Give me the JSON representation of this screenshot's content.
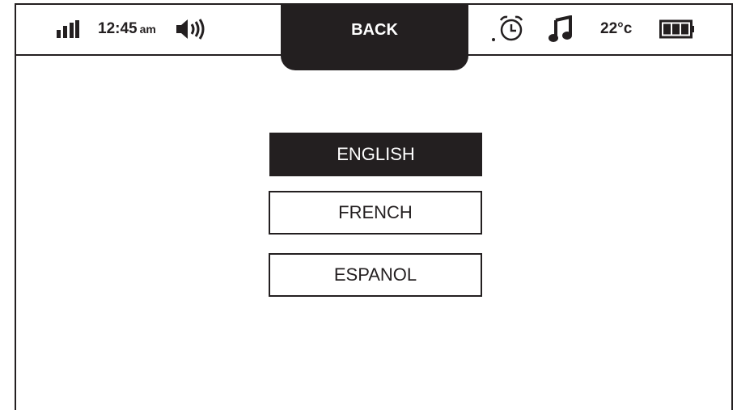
{
  "status_bar": {
    "time": "12:45",
    "ampm": "am",
    "temperature": "22°c",
    "icons": {
      "signal": "signal-bars-icon",
      "speaker": "speaker-volume-icon",
      "alarm": "alarm-clock-icon",
      "music": "music-note-icon",
      "battery": "battery-full-icon"
    }
  },
  "header": {
    "back_label": "BACK"
  },
  "languages": {
    "selected": "ENGLISH",
    "options": [
      {
        "label": "ENGLISH",
        "selected": true
      },
      {
        "label": "FRENCH",
        "selected": false
      },
      {
        "label": "ESPANOL",
        "selected": false
      }
    ]
  },
  "colors": {
    "foreground": "#231f20",
    "background": "#ffffff"
  }
}
